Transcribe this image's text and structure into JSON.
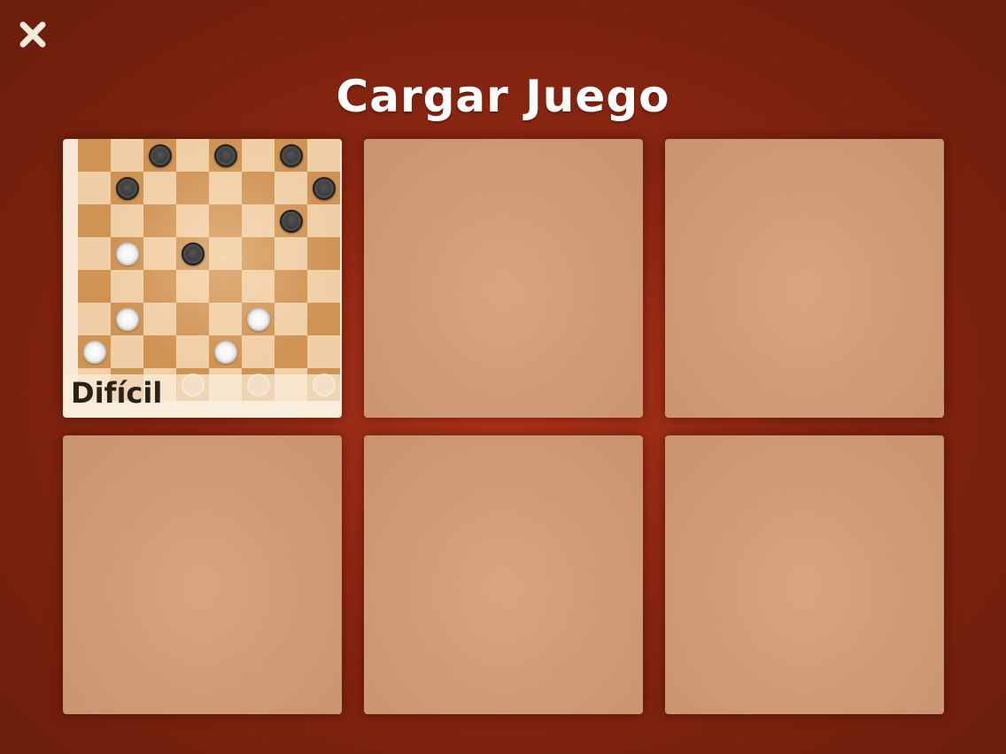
{
  "header": {
    "title": "Cargar Juego",
    "close_icon": "close-icon"
  },
  "colors": {
    "background": "#8e2712",
    "slot_empty": "#cf9c77",
    "board_light": "#f0cfa6",
    "board_dark": "#cf9354",
    "piece_black": "#3a3a3a",
    "piece_white": "#f3f3f3",
    "title": "#ffffff"
  },
  "slots": [
    {
      "label": "Difícil",
      "empty": false,
      "board": {
        "size": 8,
        "black_pieces": [
          [
            0,
            2
          ],
          [
            0,
            4
          ],
          [
            0,
            6
          ],
          [
            1,
            1
          ],
          [
            1,
            7
          ],
          [
            2,
            6
          ],
          [
            3,
            3
          ]
        ],
        "white_pieces": [
          [
            3,
            1
          ],
          [
            5,
            1
          ],
          [
            5,
            5
          ],
          [
            6,
            0
          ],
          [
            6,
            4
          ]
        ],
        "faded_pieces": [
          [
            7,
            3
          ],
          [
            7,
            5
          ],
          [
            7,
            7
          ]
        ]
      }
    },
    {
      "label": "",
      "empty": true
    },
    {
      "label": "",
      "empty": true
    },
    {
      "label": "",
      "empty": true
    },
    {
      "label": "",
      "empty": true
    },
    {
      "label": "",
      "empty": true
    }
  ]
}
